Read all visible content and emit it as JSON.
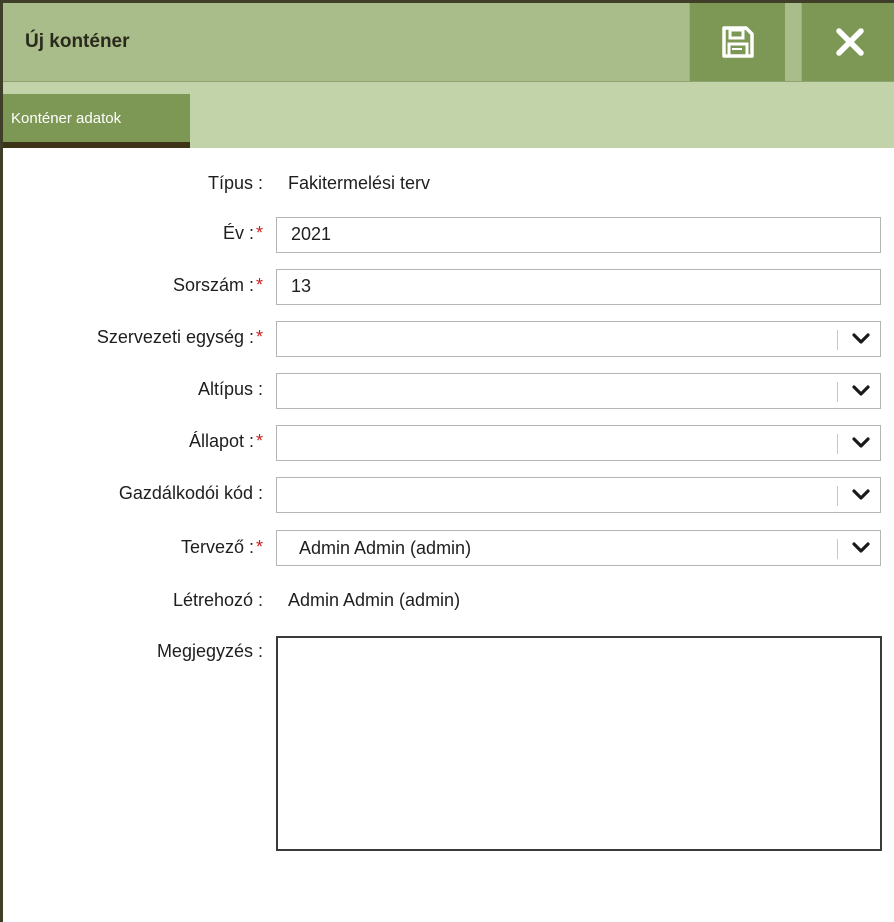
{
  "dialog": {
    "title": "Új konténer",
    "save_icon": "save-icon",
    "close_icon": "close-icon"
  },
  "tabs": [
    {
      "label": "Konténer adatok",
      "active": true
    }
  ],
  "form": {
    "tipus": {
      "label": "Típus :",
      "value": "Fakitermelési terv"
    },
    "ev": {
      "label": "Év :",
      "required": "*",
      "value": "2021"
    },
    "sorszam": {
      "label": "Sorszám :",
      "required": "*",
      "value": "13"
    },
    "szervezeti_egyseg": {
      "label": "Szervezeti egység :",
      "required": "*",
      "value": ""
    },
    "altipus": {
      "label": "Altípus :",
      "value": ""
    },
    "allapot": {
      "label": "Állapot :",
      "required": "*",
      "value": ""
    },
    "gazdalkodoi_kod": {
      "label": "Gazdálkodói kód :",
      "value": ""
    },
    "tervezo": {
      "label": "Tervező :",
      "required": "*",
      "value": "Admin Admin (admin)"
    },
    "letrehozo": {
      "label": "Létrehozó :",
      "value": "Admin Admin (admin)"
    },
    "megjegyzes": {
      "label": "Megjegyzés :",
      "value": ""
    }
  },
  "colors": {
    "titlebar": "#a9bd8a",
    "button": "#7d9755",
    "tabbar": "#c3d3a9",
    "required": "#d11a1a"
  }
}
